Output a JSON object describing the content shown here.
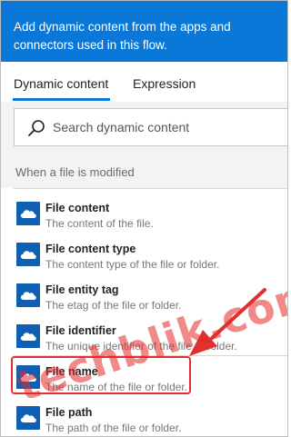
{
  "header": {
    "text": "Add dynamic content from the apps and connectors used in this flow."
  },
  "tabs": [
    {
      "label": "Dynamic content",
      "active": true
    },
    {
      "label": "Expression",
      "active": false
    }
  ],
  "search": {
    "placeholder": "Search dynamic content",
    "value": ""
  },
  "section": {
    "title": "When a file is modified"
  },
  "items": [
    {
      "name": "File content",
      "description": "The content of the file."
    },
    {
      "name": "File content type",
      "description": "The content type of the file or folder."
    },
    {
      "name": "File entity tag",
      "description": "The etag of the file or folder."
    },
    {
      "name": "File identifier",
      "description": "The unique identifier of the file or folder."
    },
    {
      "name": "File name",
      "description": "The name of the file or folder."
    },
    {
      "name": "File path",
      "description": "The path of the file or folder."
    }
  ],
  "annotation": {
    "highlighted_item": "File name",
    "color": "#e03030"
  },
  "watermark": {
    "text": "techblik.com"
  },
  "colors": {
    "accent": "#0a78d8",
    "icon_bg": "#0f5fb4"
  }
}
